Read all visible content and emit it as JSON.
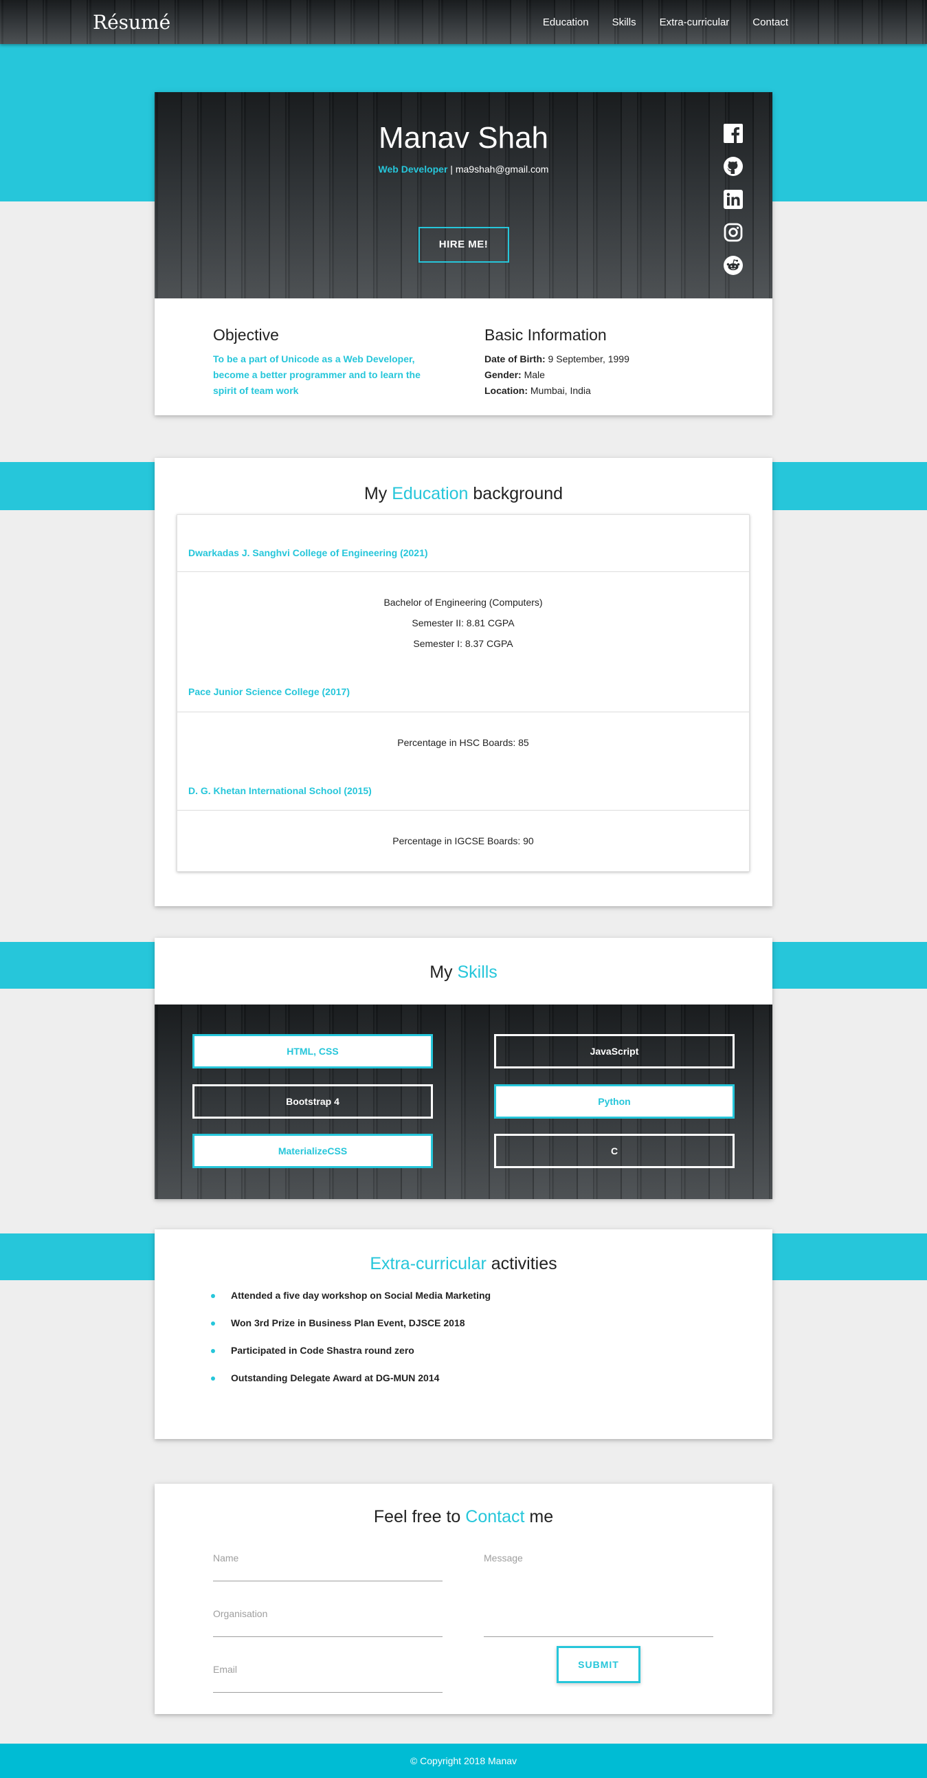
{
  "nav": {
    "brand": "Résumé",
    "links": [
      "Education",
      "Skills",
      "Extra-curricular",
      "Contact"
    ]
  },
  "hero": {
    "name": "Manav Shah",
    "role": "Web Developer",
    "separator": " | ",
    "email": "ma9shah@gmail.com",
    "hire_label": "HIRE ME!",
    "social_icons": [
      "facebook-icon",
      "github-icon",
      "linkedin-icon",
      "instagram-icon",
      "reddit-icon"
    ]
  },
  "objective": {
    "title": "Objective",
    "text": "To be a part of Unicode as a Web Developer, become a better programmer and to learn the spirit of team work"
  },
  "basic": {
    "title": "Basic Information",
    "dob_label": "Date of Birth:",
    "dob_value": " 9 September, 1999",
    "gender_label": "Gender:",
    "gender_value": " Male",
    "location_label": "Location:",
    "location_value": " Mumbai, India"
  },
  "education": {
    "title_pre": "My ",
    "title_accent": "Education",
    "title_post": " background",
    "entries": [
      {
        "school": "Dwarkadas J. Sanghvi College of Engineering (2021)",
        "lines": [
          "Bachelor of Engineering (Computers)",
          "Semester II: 8.81 CGPA",
          "Semester I: 8.37 CGPA"
        ]
      },
      {
        "school": "Pace Junior Science College (2017)",
        "lines": [
          "Percentage in HSC Boards: 85"
        ]
      },
      {
        "school": "D. G. Khetan International School (2015)",
        "lines": [
          "Percentage in IGCSE Boards: 90"
        ]
      }
    ]
  },
  "skills": {
    "title_pre": "My ",
    "title_accent": "Skills",
    "items": [
      "HTML, CSS",
      "JavaScript",
      "Bootstrap 4",
      "Python",
      "MaterializeCSS",
      "C"
    ]
  },
  "activities": {
    "title_accent": "Extra-curricular",
    "title_post": " activities",
    "items": [
      "Attended a five day workshop on Social Media Marketing",
      "Won 3rd Prize in Business Plan Event, DJSCE 2018",
      "Participated in Code Shastra round zero",
      "Outstanding Delegate Award at DG-MUN 2014"
    ]
  },
  "contact": {
    "title_pre": "Feel free to ",
    "title_accent": "Contact",
    "title_post": " me",
    "name_placeholder": "Name",
    "org_placeholder": "Organisation",
    "email_placeholder": "Email",
    "message_placeholder": "Message",
    "submit_label": "SUBMIT"
  },
  "footer": {
    "text": "© Copyright 2018 Manav"
  },
  "colors": {
    "accent": "#26c6da",
    "footer": "#00bcd4",
    "background": "#eeeeee"
  }
}
